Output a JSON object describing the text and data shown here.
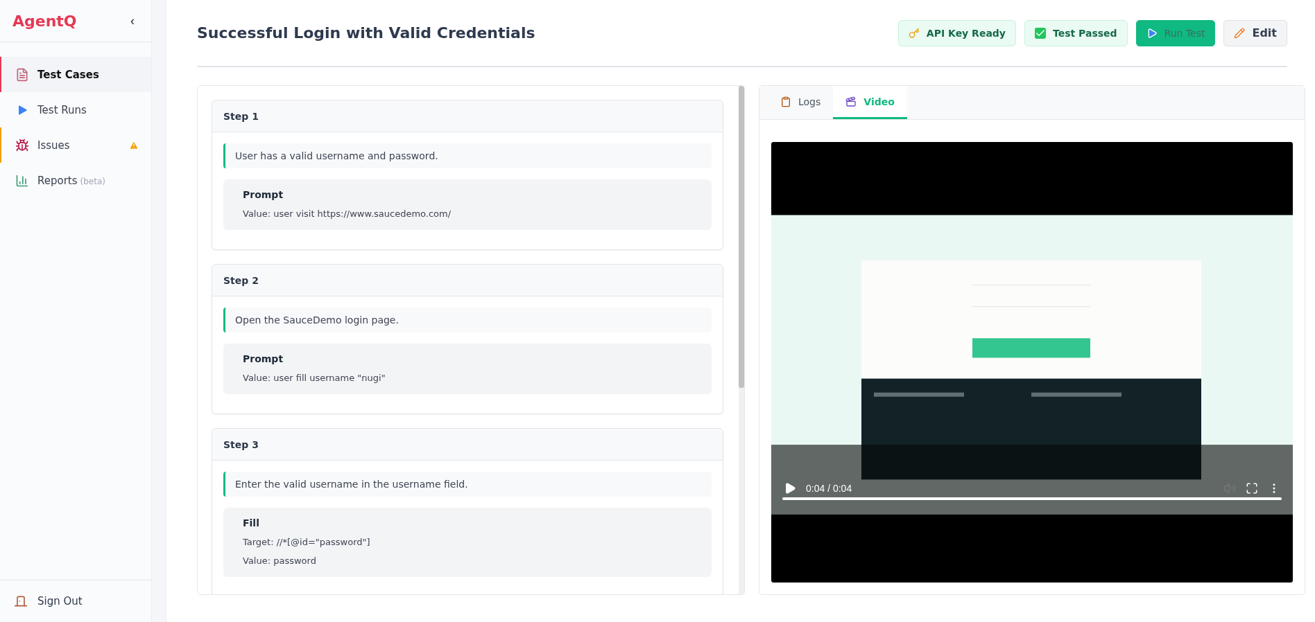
{
  "sidebar": {
    "logo": "AgentQ",
    "collapse": "‹",
    "items": [
      {
        "label": "Test Cases",
        "selected": true,
        "warning": false
      },
      {
        "label": "Test Runs",
        "selected": false,
        "warning": false
      },
      {
        "label": "Issues",
        "selected": false,
        "warning": true
      },
      {
        "label": "Reports",
        "note": "(beta)",
        "selected": false,
        "warning": false
      }
    ],
    "sign_out": "Sign Out"
  },
  "header": {
    "title": "Successful Login with Valid Credentials",
    "buttons": [
      {
        "label": "API Key Ready",
        "kind": "status"
      },
      {
        "label": "Test Passed",
        "kind": "status"
      },
      {
        "label": "Run Test",
        "kind": "primary"
      },
      {
        "label": "Edit",
        "kind": "secondary"
      }
    ]
  },
  "steps": [
    {
      "title": "Step 1",
      "description": "User has a valid username and password.",
      "action": {
        "title": "Prompt",
        "lines": [
          "Value: user visit https://www.saucedemo.com/"
        ]
      }
    },
    {
      "title": "Step 2",
      "description": "Open the SauceDemo login page.",
      "action": {
        "title": "Prompt",
        "lines": [
          "Value: user fill username \"nugi\""
        ]
      }
    },
    {
      "title": "Step 3",
      "description": "Enter the valid username in the username field.",
      "action": {
        "title": "Fill",
        "lines": [
          "Target: //*[@id=\"password\"]",
          "Value: password"
        ]
      }
    }
  ],
  "tabs": [
    {
      "label": "Logs",
      "selected": false
    },
    {
      "label": "Video",
      "selected": true
    }
  ],
  "video": {
    "kind": "picture",
    "time": "0:04 / 0:04",
    "progress": {
      "level": 1
    }
  }
}
